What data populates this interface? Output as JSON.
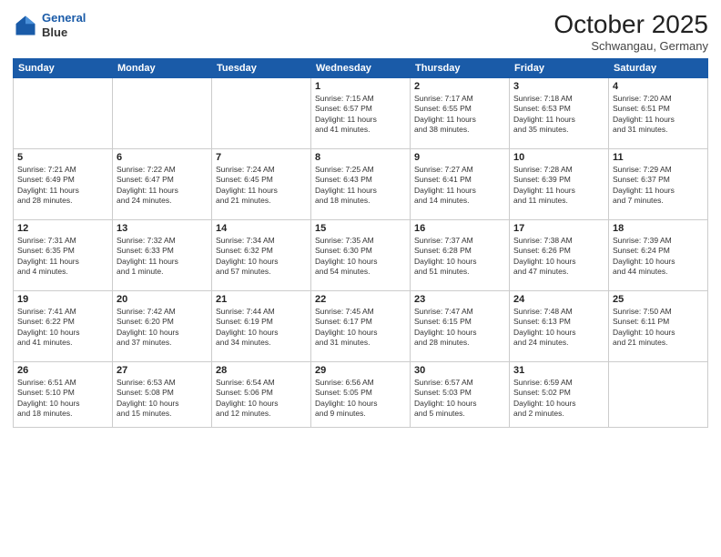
{
  "header": {
    "logo_line1": "General",
    "logo_line2": "Blue",
    "month": "October 2025",
    "location": "Schwangau, Germany"
  },
  "weekdays": [
    "Sunday",
    "Monday",
    "Tuesday",
    "Wednesday",
    "Thursday",
    "Friday",
    "Saturday"
  ],
  "weeks": [
    [
      {
        "day": "",
        "info": ""
      },
      {
        "day": "",
        "info": ""
      },
      {
        "day": "",
        "info": ""
      },
      {
        "day": "1",
        "info": "Sunrise: 7:15 AM\nSunset: 6:57 PM\nDaylight: 11 hours\nand 41 minutes."
      },
      {
        "day": "2",
        "info": "Sunrise: 7:17 AM\nSunset: 6:55 PM\nDaylight: 11 hours\nand 38 minutes."
      },
      {
        "day": "3",
        "info": "Sunrise: 7:18 AM\nSunset: 6:53 PM\nDaylight: 11 hours\nand 35 minutes."
      },
      {
        "day": "4",
        "info": "Sunrise: 7:20 AM\nSunset: 6:51 PM\nDaylight: 11 hours\nand 31 minutes."
      }
    ],
    [
      {
        "day": "5",
        "info": "Sunrise: 7:21 AM\nSunset: 6:49 PM\nDaylight: 11 hours\nand 28 minutes."
      },
      {
        "day": "6",
        "info": "Sunrise: 7:22 AM\nSunset: 6:47 PM\nDaylight: 11 hours\nand 24 minutes."
      },
      {
        "day": "7",
        "info": "Sunrise: 7:24 AM\nSunset: 6:45 PM\nDaylight: 11 hours\nand 21 minutes."
      },
      {
        "day": "8",
        "info": "Sunrise: 7:25 AM\nSunset: 6:43 PM\nDaylight: 11 hours\nand 18 minutes."
      },
      {
        "day": "9",
        "info": "Sunrise: 7:27 AM\nSunset: 6:41 PM\nDaylight: 11 hours\nand 14 minutes."
      },
      {
        "day": "10",
        "info": "Sunrise: 7:28 AM\nSunset: 6:39 PM\nDaylight: 11 hours\nand 11 minutes."
      },
      {
        "day": "11",
        "info": "Sunrise: 7:29 AM\nSunset: 6:37 PM\nDaylight: 11 hours\nand 7 minutes."
      }
    ],
    [
      {
        "day": "12",
        "info": "Sunrise: 7:31 AM\nSunset: 6:35 PM\nDaylight: 11 hours\nand 4 minutes."
      },
      {
        "day": "13",
        "info": "Sunrise: 7:32 AM\nSunset: 6:33 PM\nDaylight: 11 hours\nand 1 minute."
      },
      {
        "day": "14",
        "info": "Sunrise: 7:34 AM\nSunset: 6:32 PM\nDaylight: 10 hours\nand 57 minutes."
      },
      {
        "day": "15",
        "info": "Sunrise: 7:35 AM\nSunset: 6:30 PM\nDaylight: 10 hours\nand 54 minutes."
      },
      {
        "day": "16",
        "info": "Sunrise: 7:37 AM\nSunset: 6:28 PM\nDaylight: 10 hours\nand 51 minutes."
      },
      {
        "day": "17",
        "info": "Sunrise: 7:38 AM\nSunset: 6:26 PM\nDaylight: 10 hours\nand 47 minutes."
      },
      {
        "day": "18",
        "info": "Sunrise: 7:39 AM\nSunset: 6:24 PM\nDaylight: 10 hours\nand 44 minutes."
      }
    ],
    [
      {
        "day": "19",
        "info": "Sunrise: 7:41 AM\nSunset: 6:22 PM\nDaylight: 10 hours\nand 41 minutes."
      },
      {
        "day": "20",
        "info": "Sunrise: 7:42 AM\nSunset: 6:20 PM\nDaylight: 10 hours\nand 37 minutes."
      },
      {
        "day": "21",
        "info": "Sunrise: 7:44 AM\nSunset: 6:19 PM\nDaylight: 10 hours\nand 34 minutes."
      },
      {
        "day": "22",
        "info": "Sunrise: 7:45 AM\nSunset: 6:17 PM\nDaylight: 10 hours\nand 31 minutes."
      },
      {
        "day": "23",
        "info": "Sunrise: 7:47 AM\nSunset: 6:15 PM\nDaylight: 10 hours\nand 28 minutes."
      },
      {
        "day": "24",
        "info": "Sunrise: 7:48 AM\nSunset: 6:13 PM\nDaylight: 10 hours\nand 24 minutes."
      },
      {
        "day": "25",
        "info": "Sunrise: 7:50 AM\nSunset: 6:11 PM\nDaylight: 10 hours\nand 21 minutes."
      }
    ],
    [
      {
        "day": "26",
        "info": "Sunrise: 6:51 AM\nSunset: 5:10 PM\nDaylight: 10 hours\nand 18 minutes."
      },
      {
        "day": "27",
        "info": "Sunrise: 6:53 AM\nSunset: 5:08 PM\nDaylight: 10 hours\nand 15 minutes."
      },
      {
        "day": "28",
        "info": "Sunrise: 6:54 AM\nSunset: 5:06 PM\nDaylight: 10 hours\nand 12 minutes."
      },
      {
        "day": "29",
        "info": "Sunrise: 6:56 AM\nSunset: 5:05 PM\nDaylight: 10 hours\nand 9 minutes."
      },
      {
        "day": "30",
        "info": "Sunrise: 6:57 AM\nSunset: 5:03 PM\nDaylight: 10 hours\nand 5 minutes."
      },
      {
        "day": "31",
        "info": "Sunrise: 6:59 AM\nSunset: 5:02 PM\nDaylight: 10 hours\nand 2 minutes."
      },
      {
        "day": "",
        "info": ""
      }
    ]
  ]
}
